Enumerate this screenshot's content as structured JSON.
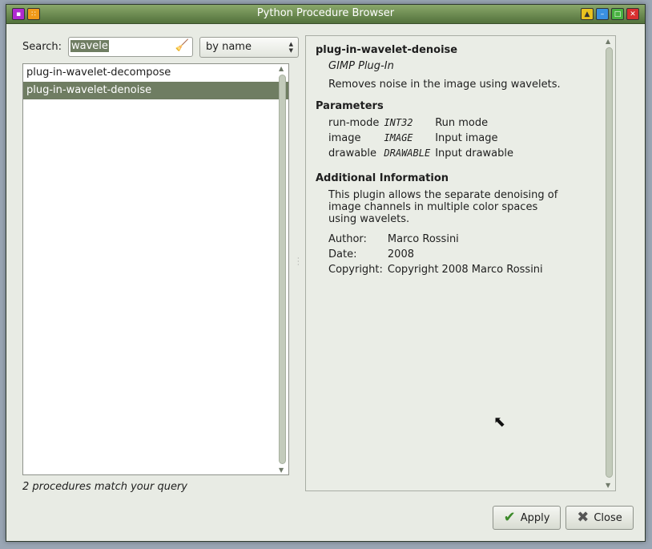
{
  "window": {
    "title": "Python Procedure Browser",
    "title_buttons": [
      "menu",
      "stick",
      "shade",
      "minimize",
      "maximize",
      "close"
    ]
  },
  "search": {
    "label": "Search:",
    "value": "wavele",
    "clear_icon": "broom-icon",
    "mode_selected": "by name"
  },
  "procedures": [
    {
      "name": "plug-in-wavelet-decompose",
      "selected": false
    },
    {
      "name": "plug-in-wavelet-denoise",
      "selected": true
    }
  ],
  "status": "2 procedures match your query",
  "detail": {
    "name": "plug-in-wavelet-denoise",
    "type": "GIMP Plug-In",
    "blurb": "Removes noise in the image using wavelets.",
    "parameters_heading": "Parameters",
    "parameters": [
      {
        "name": "run-mode",
        "type": "INT32",
        "desc": "Run mode"
      },
      {
        "name": "image",
        "type": "IMAGE",
        "desc": "Input image"
      },
      {
        "name": "drawable",
        "type": "DRAWABLE",
        "desc": "Input drawable"
      }
    ],
    "info_heading": "Additional Information",
    "help": "This plugin allows the separate denoising of image channels in multiple color spaces using wavelets.",
    "author_label": "Author:",
    "author": "Marco Rossini",
    "date_label": "Date:",
    "date": "2008",
    "copyright_label": "Copyright:",
    "copyright": "Copyright 2008 Marco Rossini"
  },
  "buttons": {
    "apply": "Apply",
    "close": "Close"
  },
  "colors": {
    "selection": "#6f7d62",
    "titlebar": "#6b8a52"
  }
}
